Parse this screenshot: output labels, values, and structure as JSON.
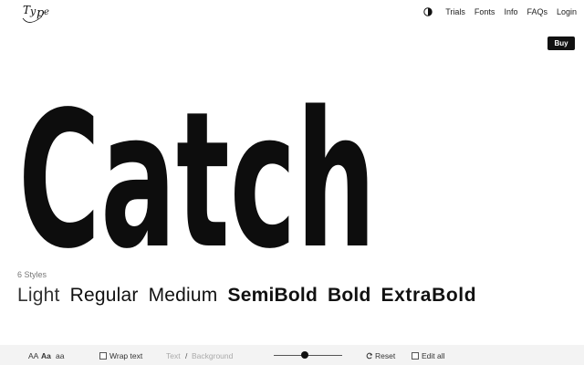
{
  "logo": {
    "text": "TyPe"
  },
  "nav": {
    "items": [
      "Trials",
      "Fonts",
      "Info",
      "FAQs",
      "Login"
    ]
  },
  "buy": "Buy",
  "hero": {
    "specimen_text": "Catch"
  },
  "styles": {
    "count_label": "6 Styles",
    "weights": [
      "Light",
      "Regular",
      "Medium",
      "SemiBold",
      "Bold",
      "ExtraBold"
    ]
  },
  "toolbar": {
    "size_large": "AA",
    "size_medium": "Aa",
    "size_small": "aa",
    "wrap_label": "Wrap text",
    "text_label": "Text",
    "slash": "/",
    "background_label": "Background",
    "slider_value": 0.45,
    "reset_label": "Reset",
    "edit_all_label": "Edit all"
  }
}
